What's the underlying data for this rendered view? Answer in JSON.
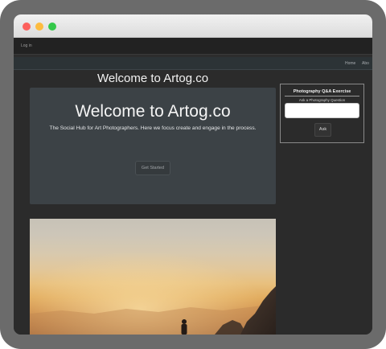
{
  "window": {
    "controls": [
      "close",
      "minimize",
      "maximize"
    ]
  },
  "topbar": {
    "login_label": "Log in"
  },
  "nav": {
    "links": [
      "Home",
      "Abo"
    ]
  },
  "main": {
    "page_title": "Welcome to Artog.co",
    "hero": {
      "title": "Welcome to Artog.co",
      "subtitle": "The Social Hub for Art Photographers. Here we focus create and engage in the process.",
      "button_label": "Get Started"
    },
    "photo": {
      "description_icon": "sunset-hill-photo-icon"
    }
  },
  "sidebar": {
    "title": "Photography Q&A Exercise",
    "label": "Ask a Photography Question",
    "input_value": "",
    "ask_label": "Ask"
  },
  "colors": {
    "page_background": "#2b2b2b",
    "hero_background": "#3c4246",
    "navbar_background": "#2c3336",
    "close": "#fc605c",
    "minimize": "#fdbc40",
    "maximize": "#34c84a"
  }
}
